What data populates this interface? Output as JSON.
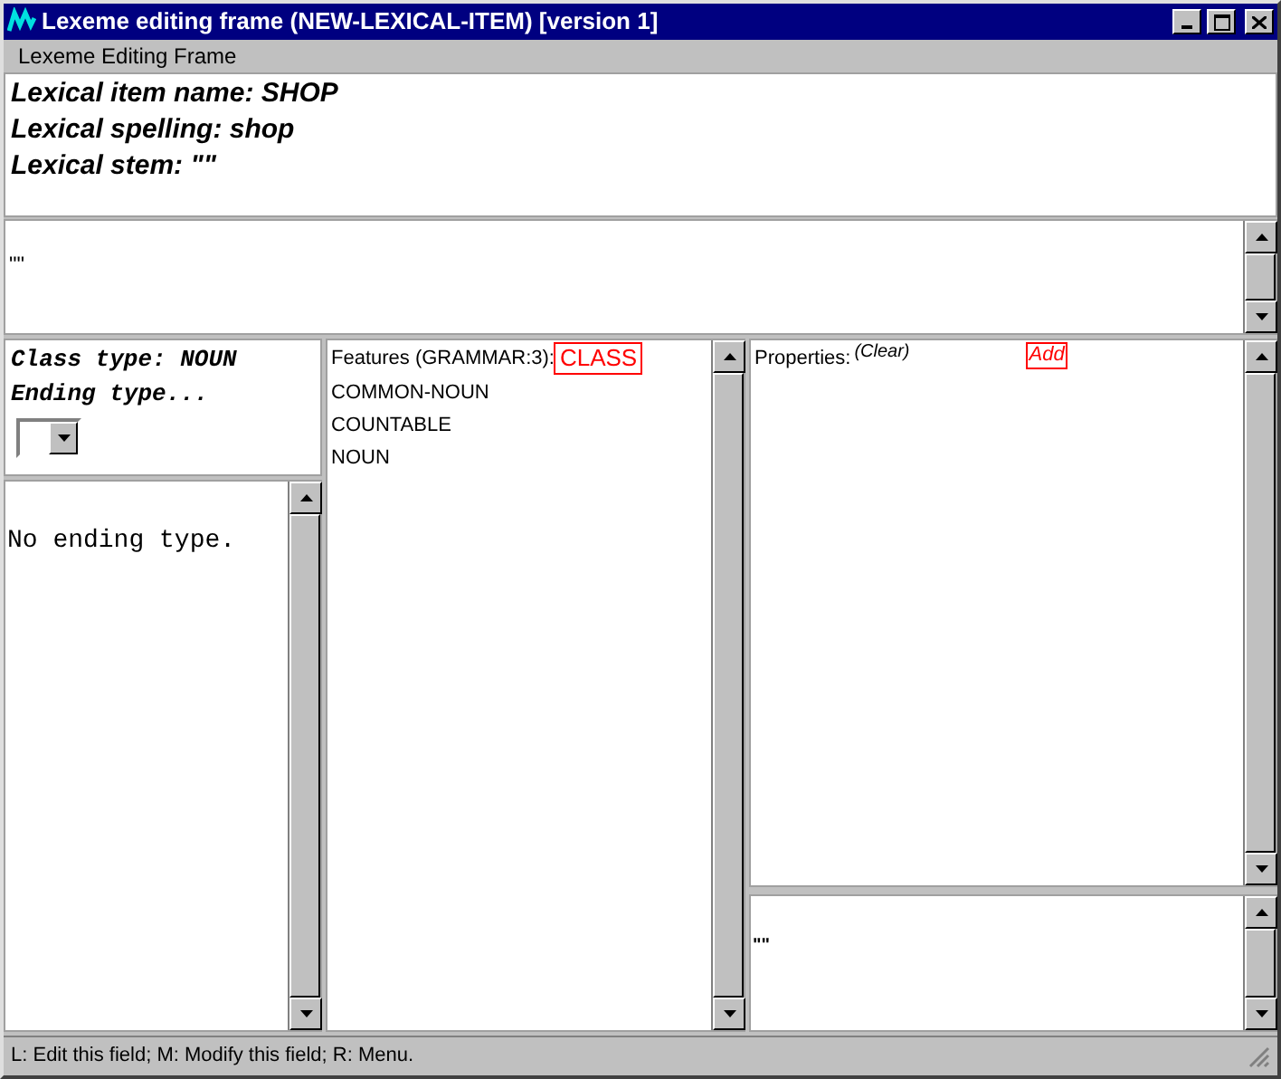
{
  "window": {
    "title": "Lexeme editing frame (NEW-LEXICAL-ITEM) [version 1]"
  },
  "menu": [
    "Lexeme Editing Frame"
  ],
  "header_lines": [
    "Lexical item name: SHOP",
    "Lexical spelling: shop",
    "Lexical stem: \"\""
  ],
  "stem_panel": {
    "text": "\"\""
  },
  "class_panel": {
    "class_type": "Class type: NOUN",
    "ending_label": "Ending type..."
  },
  "ending_panel": {
    "text": "No ending type."
  },
  "features": {
    "label": "Features (GRAMMAR:3):",
    "button": "CLASS",
    "items": [
      "COMMON-NOUN",
      "COUNTABLE",
      "NOUN"
    ]
  },
  "properties": {
    "label": "Properties:",
    "clear": "(Clear)",
    "add": "Add"
  },
  "properties_value": {
    "text": "\"\""
  },
  "status_bar": "L: Edit this field; M: Modify this field; R: Menu."
}
